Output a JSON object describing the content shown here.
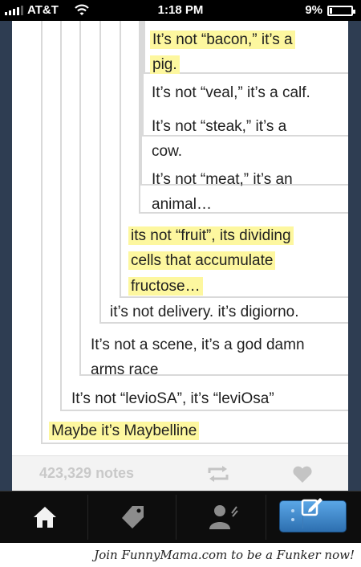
{
  "status_bar": {
    "carrier": "AT&T",
    "time": "1:18 PM",
    "battery_percent": "9%",
    "battery_level": 0.09
  },
  "post": {
    "quotes": [
      {
        "lines": [
          "It’s not “bacon,” it’s a",
          "pig."
        ],
        "highlighted": true
      },
      {
        "lines": [
          "It’s not “veal,” it’s a calf."
        ],
        "highlighted": false
      },
      {
        "lines": [
          "It’s not “steak,” it’s a",
          "cow."
        ],
        "highlighted": false
      },
      {
        "lines": [
          "It’s not “meat,” it’s an",
          "animal…"
        ],
        "highlighted": false
      },
      {
        "lines": [
          "its not “fruit”, its dividing",
          "cells that accumulate",
          "fructose…"
        ],
        "highlighted": true
      },
      {
        "lines": [
          "it’s not delivery. it’s digiorno."
        ],
        "highlighted": false
      },
      {
        "lines": [
          "It’s not a scene, it’s a god damn",
          "arms race"
        ],
        "highlighted": false
      },
      {
        "lines": [
          "It’s not “levioSA”, it’s “leviOsa”"
        ],
        "highlighted": false
      },
      {
        "lines": [
          "Maybe it’s Maybelline"
        ],
        "highlighted": true
      }
    ],
    "notes": "423,329 notes"
  },
  "icons": {
    "footer": [
      "reblog-icon",
      "heart-icon"
    ],
    "tabs": [
      "home-icon",
      "tag-icon",
      "account-icon",
      "compose-icon"
    ]
  },
  "colors": {
    "highlight": "#fdf79f",
    "sidebar": "#2e3d52",
    "compose_button": "#3a86cc"
  },
  "watermark": "Join FunnyMama.com to be a Funker now!"
}
